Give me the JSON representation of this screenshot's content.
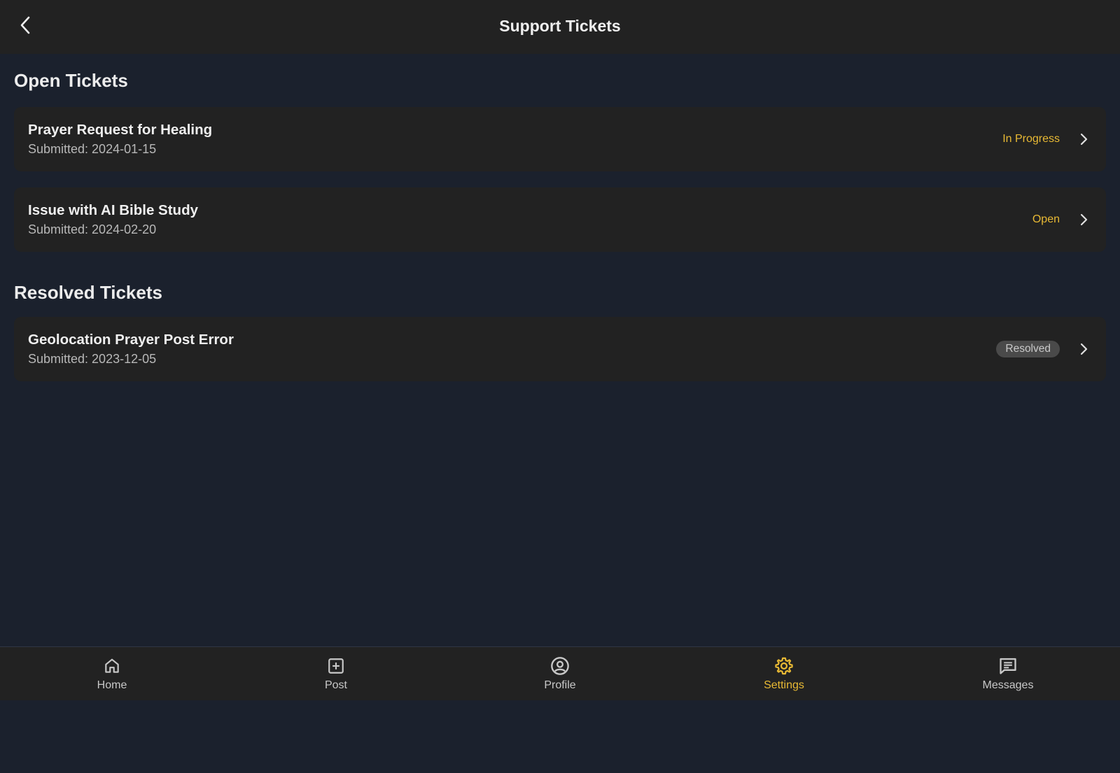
{
  "header": {
    "title": "Support Tickets",
    "back_icon": "chevron-left-icon"
  },
  "sections": {
    "open": {
      "title": "Open Tickets",
      "tickets": [
        {
          "title": "Prayer Request for Healing",
          "submitted": "Submitted: 2024-01-15",
          "status": "In Progress"
        },
        {
          "title": "Issue with AI Bible Study",
          "submitted": "Submitted: 2024-02-20",
          "status": "Open"
        }
      ]
    },
    "resolved": {
      "title": "Resolved Tickets",
      "tickets": [
        {
          "title": "Geolocation Prayer Post Error",
          "submitted": "Submitted: 2023-12-05",
          "status": "Resolved"
        }
      ]
    }
  },
  "nav": {
    "items": [
      {
        "label": "Home",
        "icon": "home-icon"
      },
      {
        "label": "Post",
        "icon": "plus-square-icon"
      },
      {
        "label": "Profile",
        "icon": "user-circle-icon"
      },
      {
        "label": "Settings",
        "icon": "gear-icon",
        "active": true
      },
      {
        "label": "Messages",
        "icon": "message-icon"
      }
    ]
  },
  "colors": {
    "background": "#1b212d",
    "surface": "#222222",
    "accent": "#e8b934",
    "resolved_badge": "#4a4a4a"
  }
}
